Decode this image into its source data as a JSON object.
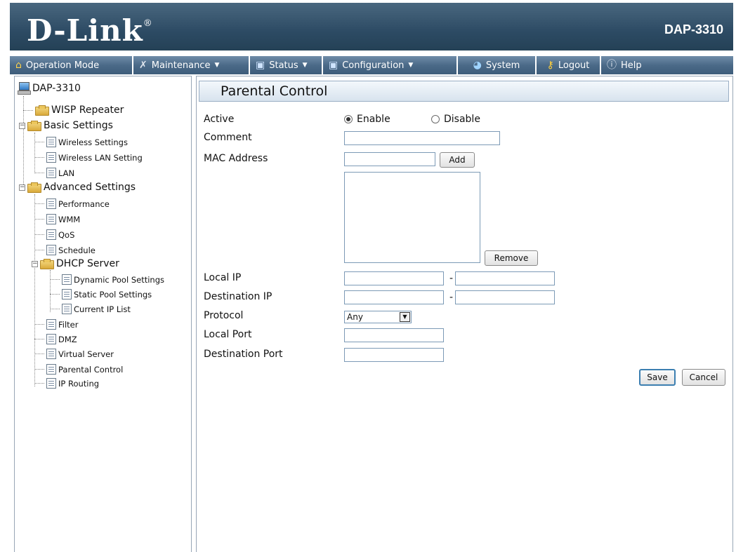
{
  "header": {
    "logo": "D-Link",
    "logo_mark": "®",
    "model": "DAP-3310"
  },
  "menu": [
    {
      "label": "Operation Mode",
      "icon": "home-icon",
      "dropdown": false
    },
    {
      "label": "Maintenance",
      "icon": "tools-icon",
      "dropdown": true
    },
    {
      "label": "Status",
      "icon": "disk-icon",
      "dropdown": true
    },
    {
      "label": "Configuration",
      "icon": "disk-icon",
      "dropdown": true
    },
    {
      "label": "System",
      "icon": "system-icon",
      "dropdown": false
    },
    {
      "label": "Logout",
      "icon": "key-icon",
      "dropdown": false
    },
    {
      "label": "Help",
      "icon": "help-icon",
      "dropdown": false
    }
  ],
  "tree": {
    "root": "DAP-3310",
    "wisp": "WISP Repeater",
    "basic": "Basic Settings",
    "basic_items": [
      "Wireless Settings",
      "Wireless LAN Setting",
      "LAN"
    ],
    "advanced": "Advanced Settings",
    "advanced_items_a": [
      "Performance",
      "WMM",
      "QoS",
      "Schedule"
    ],
    "dhcp": "DHCP Server",
    "dhcp_items": [
      "Dynamic Pool Settings",
      "Static Pool Settings",
      "Current IP List"
    ],
    "advanced_items_b": [
      "Filter",
      "DMZ",
      "Virtual Server",
      "Parental Control",
      "IP Routing"
    ]
  },
  "form": {
    "title": "Parental Control",
    "active_label": "Active",
    "enable_label": "Enable",
    "disable_label": "Disable",
    "active_value": "Enable",
    "comment_label": "Comment",
    "comment_value": "",
    "mac_label": "MAC Address",
    "mac_value": "",
    "add_button": "Add",
    "remove_button": "Remove",
    "local_ip_label": "Local IP",
    "dest_ip_label": "Destination IP",
    "ip_separator": "-",
    "protocol_label": "Protocol",
    "protocol_value": "Any",
    "local_port_label": "Local Port",
    "dest_port_label": "Destination Port",
    "save_button": "Save",
    "cancel_button": "Cancel"
  },
  "colors": {
    "header_bg": "#2d4b64",
    "menu_bg": "#4b6a88",
    "title_bar_bg": "#d8e3ee",
    "field_border": "#7c9ab6"
  }
}
